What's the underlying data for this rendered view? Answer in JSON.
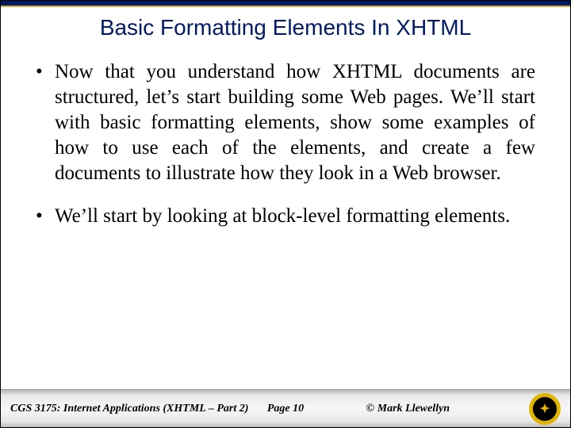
{
  "title": "Basic Formatting Elements In XHTML",
  "bullets": [
    "Now that you understand how XHTML documents are structured, let’s start building some Web pages.  We’ll start with basic formatting elements, show some examples of how to use each of the elements, and create a few documents to illustrate how they look in a Web browser.",
    "We’ll start by looking at block-level formatting elements."
  ],
  "footer": {
    "left": "CGS 3175: Internet Applications (XHTML – Part 2)",
    "center": "Page 10",
    "right": "© Mark Llewellyn"
  }
}
